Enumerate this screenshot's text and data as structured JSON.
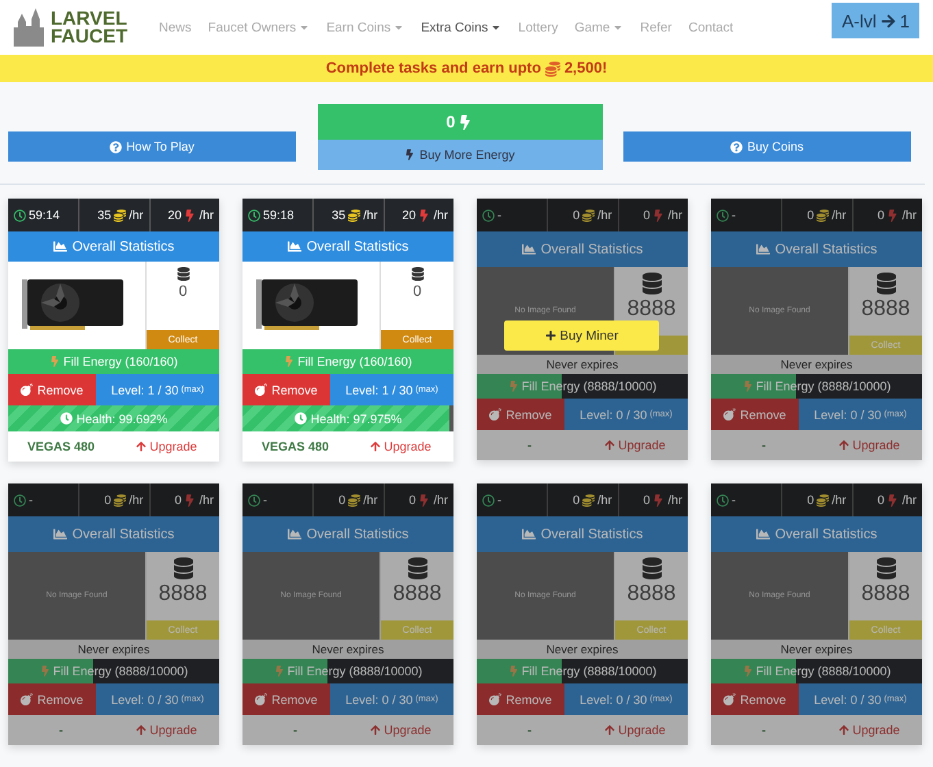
{
  "logo": {
    "line_1": "LARVEL",
    "line_2": "FAUCET"
  },
  "nav": [
    {
      "label": "News",
      "dropdown": false,
      "selected": false
    },
    {
      "label": "Faucet Owners",
      "dropdown": true,
      "selected": false
    },
    {
      "label": "Earn Coins",
      "dropdown": true,
      "selected": false
    },
    {
      "label": "Extra Coins",
      "dropdown": true,
      "selected": true
    },
    {
      "label": "Lottery",
      "dropdown": false,
      "selected": false
    },
    {
      "label": "Game",
      "dropdown": true,
      "selected": false
    },
    {
      "label": "Refer",
      "dropdown": false,
      "selected": false
    },
    {
      "label": "Contact",
      "dropdown": false,
      "selected": false
    }
  ],
  "account_button": {
    "label": "A-lvl",
    "level": "1"
  },
  "banner": {
    "text": "Complete tasks and earn upto",
    "amount": "2,500!"
  },
  "actions": {
    "how_to_play": "How To Play",
    "energy": "0",
    "buy_energy": "Buy More Energy",
    "buy_coins": "Buy Coins"
  },
  "miners": [
    {
      "kind": "owned",
      "timer": "59:14",
      "coin_rate": "35",
      "coin_unit": "/hr",
      "energy_rate": "20",
      "energy_unit": "/hr",
      "header": "Overall Statistics",
      "coins": "0",
      "collect": "Collect",
      "energy": {
        "label": "Fill Energy (160/160)",
        "level": 1
      },
      "remove": "Remove",
      "level_text": "Level: 1 / 30",
      "level_max": "(max)",
      "health": {
        "label": "Health: 99.692%",
        "level": 0.997
      },
      "name": "VEGAS 480",
      "upgrade": "Upgrade"
    },
    {
      "kind": "owned",
      "timer": "59:18",
      "coin_rate": "35",
      "coin_unit": "/hr",
      "energy_rate": "20",
      "energy_unit": "/hr",
      "header": "Overall Statistics",
      "coins": "0",
      "collect": "Collect",
      "energy": {
        "label": "Fill Energy (160/160)",
        "level": 1
      },
      "remove": "Remove",
      "level_text": "Level: 1 / 30",
      "level_max": "(max)",
      "health": {
        "label": "Health: 97.975%",
        "level": 0.98
      },
      "name": "VEGAS 480",
      "upgrade": "Upgrade"
    },
    {
      "kind": "empty",
      "timer": "-",
      "coin_rate": "0",
      "coin_unit": "/hr",
      "energy_rate": "0",
      "energy_unit": "/hr",
      "header": "Overall Statistics",
      "no_image": "No Image Found",
      "coins": "8888",
      "expiry": "Never expires",
      "energy": {
        "label": "Fill Energy (8888/10000)",
        "level": 0.4
      },
      "remove": "Remove",
      "level_text": "Level: 0 / 30",
      "level_max": "(max)",
      "name": "-",
      "upgrade": "Upgrade",
      "buy": "Buy Miner"
    },
    {
      "kind": "empty",
      "timer": "-",
      "coin_rate": "0",
      "coin_unit": "/hr",
      "energy_rate": "0",
      "energy_unit": "/hr",
      "header": "Overall Statistics",
      "no_image": "No Image Found",
      "coins": "8888",
      "collect": "Collect",
      "expiry": "Never expires",
      "energy": {
        "label": "Fill Energy (8888/10000)",
        "level": 0.4
      },
      "remove": "Remove",
      "level_text": "Level: 0 / 30",
      "level_max": "(max)",
      "name": "-",
      "upgrade": "Upgrade"
    },
    {
      "kind": "empty",
      "timer": "-",
      "coin_rate": "0",
      "coin_unit": "/hr",
      "energy_rate": "0",
      "energy_unit": "/hr",
      "header": "Overall Statistics",
      "no_image": "No Image Found",
      "coins": "8888",
      "collect": "Collect",
      "expiry": "Never expires",
      "energy": {
        "label": "Fill Energy (8888/10000)",
        "level": 0.4
      },
      "remove": "Remove",
      "level_text": "Level: 0 / 30",
      "level_max": "(max)",
      "name": "-",
      "upgrade": "Upgrade"
    },
    {
      "kind": "empty",
      "timer": "-",
      "coin_rate": "0",
      "coin_unit": "/hr",
      "energy_rate": "0",
      "energy_unit": "/hr",
      "header": "Overall Statistics",
      "no_image": "No Image Found",
      "coins": "8888",
      "collect": "Collect",
      "expiry": "Never expires",
      "energy": {
        "label": "Fill Energy (8888/10000)",
        "level": 0.4
      },
      "remove": "Remove",
      "level_text": "Level: 0 / 30",
      "level_max": "(max)",
      "name": "-",
      "upgrade": "Upgrade"
    },
    {
      "kind": "empty",
      "timer": "-",
      "coin_rate": "0",
      "coin_unit": "/hr",
      "energy_rate": "0",
      "energy_unit": "/hr",
      "header": "Overall Statistics",
      "no_image": "No Image Found",
      "coins": "8888",
      "collect": "Collect",
      "expiry": "Never expires",
      "energy": {
        "label": "Fill Energy (8888/10000)",
        "level": 0.4
      },
      "remove": "Remove",
      "level_text": "Level: 0 / 30",
      "level_max": "(max)",
      "name": "-",
      "upgrade": "Upgrade"
    },
    {
      "kind": "empty",
      "timer": "-",
      "coin_rate": "0",
      "coin_unit": "/hr",
      "energy_rate": "0",
      "energy_unit": "/hr",
      "header": "Overall Statistics",
      "no_image": "No Image Found",
      "coins": "8888",
      "collect": "Collect",
      "expiry": "Never expires",
      "energy": {
        "label": "Fill Energy (8888/10000)",
        "level": 0.4
      },
      "remove": "Remove",
      "level_text": "Level: 0 / 30",
      "level_max": "(max)",
      "name": "-",
      "upgrade": "Upgrade"
    }
  ]
}
